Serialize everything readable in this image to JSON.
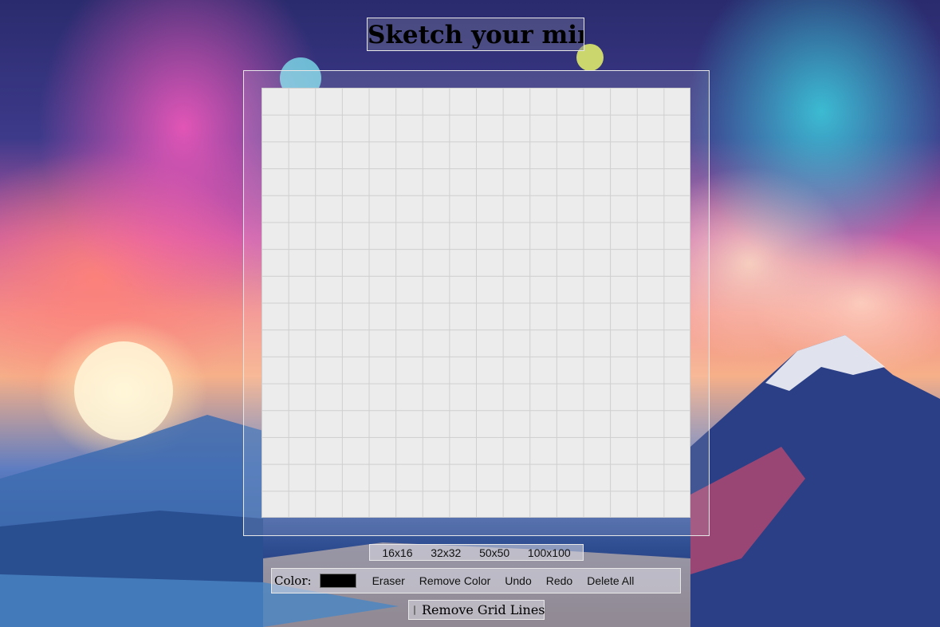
{
  "title": "Sketch your mind",
  "sizes": [
    "16x16",
    "32x32",
    "50x50",
    "100x100"
  ],
  "toolbar": {
    "color_label": "Color:",
    "color_value": "#000000",
    "eraser": "Eraser",
    "remove_color": "Remove Color",
    "undo": "Undo",
    "redo": "Redo",
    "delete_all": "Delete All"
  },
  "grid_option": {
    "label": "Remove Grid Lines",
    "checked": false
  },
  "canvas": {
    "grid_size": 16,
    "cell_color": "#ececec",
    "line_color": "#cfcfcf"
  }
}
